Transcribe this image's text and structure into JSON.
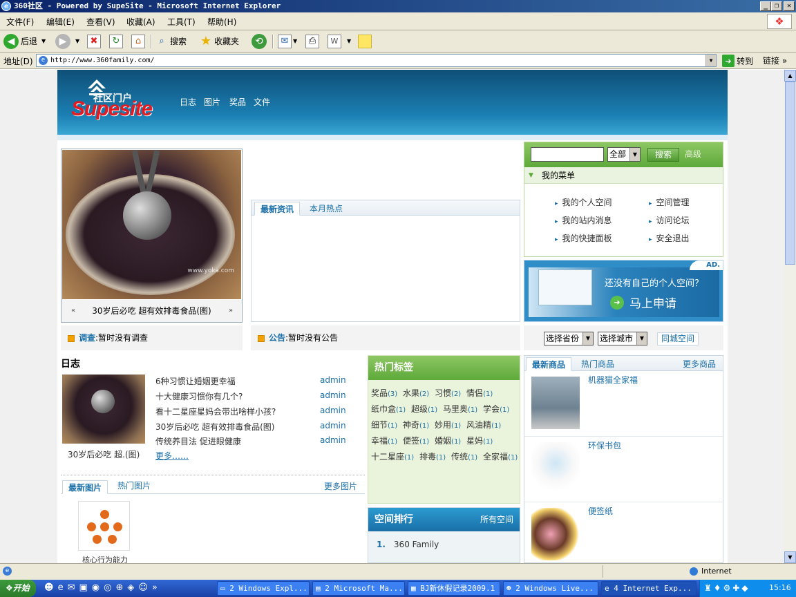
{
  "window": {
    "title": "360社区 - Powered by SupeSite - Microsoft Internet Explorer"
  },
  "menu": [
    "文件(F)",
    "编辑(E)",
    "查看(V)",
    "收藏(A)",
    "工具(T)",
    "帮助(H)"
  ],
  "toolbar": {
    "back": "后退",
    "search": "搜索",
    "favorites": "收藏夹"
  },
  "address": {
    "label": "地址(D)",
    "url": "http://www.360family.com/",
    "go": "转到",
    "links": "链接"
  },
  "site": {
    "logo_cn": "社区门户",
    "logo_en": "Supesite",
    "nav": [
      "日志",
      "图片",
      "奖品",
      "文件"
    ]
  },
  "hero": {
    "caption": "30岁后必吃 超有效排毒食品(图)",
    "prev": "«",
    "next": "»",
    "watermark": "www.yoka.com"
  },
  "news": {
    "tabs": [
      "最新资讯",
      "本月热点"
    ]
  },
  "search": {
    "scope": "全部",
    "button": "搜索",
    "advanced": "高级"
  },
  "my_menu": {
    "title": "我的菜单",
    "items": [
      "我的个人空间",
      "空间管理",
      "我的站内消息",
      "访问论坛",
      "我的快捷面板",
      "安全退出"
    ]
  },
  "ad": {
    "tag": "AD.",
    "text": "还没有自己的个人空间？",
    "cta": "马上申请"
  },
  "poll": {
    "label": "调查",
    "text": ":暂时没有调查"
  },
  "notice": {
    "label": "公告",
    "text": ":暂时没有公告"
  },
  "location": {
    "province": "选择省份",
    "city": "选择城市",
    "button": "同城空间"
  },
  "blog": {
    "title": "日志",
    "thumb_caption": "30岁后必吃 超.(图)",
    "items": [
      {
        "title": "6种习惯让婚姻更幸福",
        "author": "admin"
      },
      {
        "title": "十大健康习惯你有几个?",
        "author": "admin"
      },
      {
        "title": "看十二星座星妈会带出啥样小孩?",
        "author": "admin"
      },
      {
        "title": "30岁后必吃 超有效排毒食品(图)",
        "author": "admin"
      },
      {
        "title": "传统养目法 促进眼健康",
        "author": "admin"
      }
    ],
    "more": "更多……"
  },
  "pics": {
    "tabs": [
      "最新图片",
      "热门图片"
    ],
    "more": "更多图片",
    "item_caption": "核心行为能力"
  },
  "tags": {
    "title": "热门标签",
    "lines": [
      [
        [
          "奖品",
          "(3)"
        ],
        [
          "水果",
          "(2)"
        ],
        [
          "习惯",
          "(2)"
        ],
        [
          "情侣",
          "(1)"
        ]
      ],
      [
        [
          "纸巾盒",
          "(1)"
        ],
        [
          "超级",
          "(1)"
        ],
        [
          "马里奥",
          "(1)"
        ],
        [
          "学会",
          "(1)"
        ]
      ],
      [
        [
          "细节",
          "(1)"
        ],
        [
          "神奇",
          "(1)"
        ],
        [
          "妙用",
          "(1)"
        ],
        [
          "风油精",
          "(1)"
        ]
      ],
      [
        [
          "幸福",
          "(1)"
        ],
        [
          "便签",
          "(1)"
        ],
        [
          "婚姻",
          "(1)"
        ],
        [
          "星妈",
          "(1)"
        ]
      ],
      [
        [
          "十二星座",
          "(1)"
        ],
        [
          "排毒",
          "(1)"
        ],
        [
          "传统",
          "(1)"
        ],
        [
          "全家福",
          "(1)"
        ]
      ]
    ]
  },
  "rank": {
    "title": "空间排行",
    "all": "所有空间",
    "items": [
      {
        "no": "1.",
        "name": "360 Family"
      }
    ]
  },
  "goods": {
    "tabs": [
      "最新商品",
      "热门商品"
    ],
    "more": "更多商品",
    "items": [
      "机器猫全家福",
      "环保书包",
      "便签纸"
    ]
  },
  "status": {
    "zone": "Internet"
  },
  "taskbar": {
    "start": "开始",
    "tasks": [
      "2 Windows Expl...",
      "2 Microsoft Ma...",
      "BJ新休假记录2009.1",
      "2 Windows Live...",
      "4 Internet Exp..."
    ],
    "time": "15:16"
  }
}
